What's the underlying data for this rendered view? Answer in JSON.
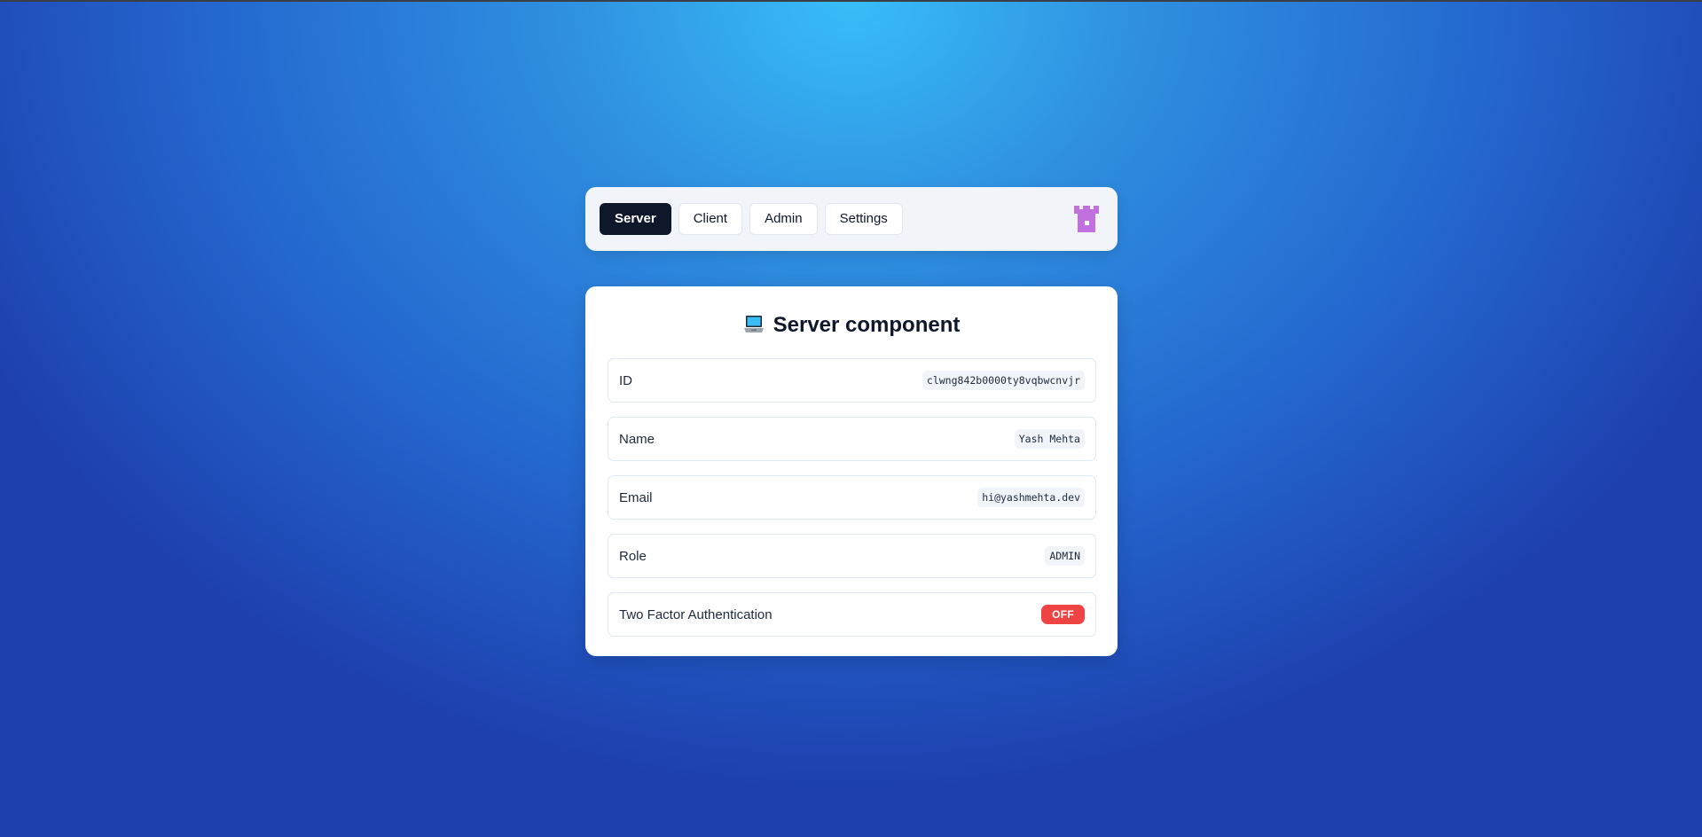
{
  "nav": {
    "tabs": [
      {
        "label": "Server",
        "active": true
      },
      {
        "label": "Client",
        "active": false
      },
      {
        "label": "Admin",
        "active": false
      },
      {
        "label": "Settings",
        "active": false
      }
    ],
    "logo_icon": "castle-icon"
  },
  "card": {
    "title_icon": "laptop-icon",
    "title": "Server component",
    "rows": [
      {
        "label": "ID",
        "value": "clwng842b0000ty8vqbwcnvjr"
      },
      {
        "label": "Name",
        "value": "Yash Mehta"
      },
      {
        "label": "Email",
        "value": "hi@yashmehta.dev"
      },
      {
        "label": "Role",
        "value": "ADMIN"
      },
      {
        "label": "Two Factor Authentication",
        "value": "OFF"
      }
    ]
  },
  "colors": {
    "active_tab": "#0f172a",
    "logo": "#c26fe0",
    "off_badge": "#ef4444",
    "background_top": "#38bdf8",
    "background_bottom": "#1e3fae"
  }
}
